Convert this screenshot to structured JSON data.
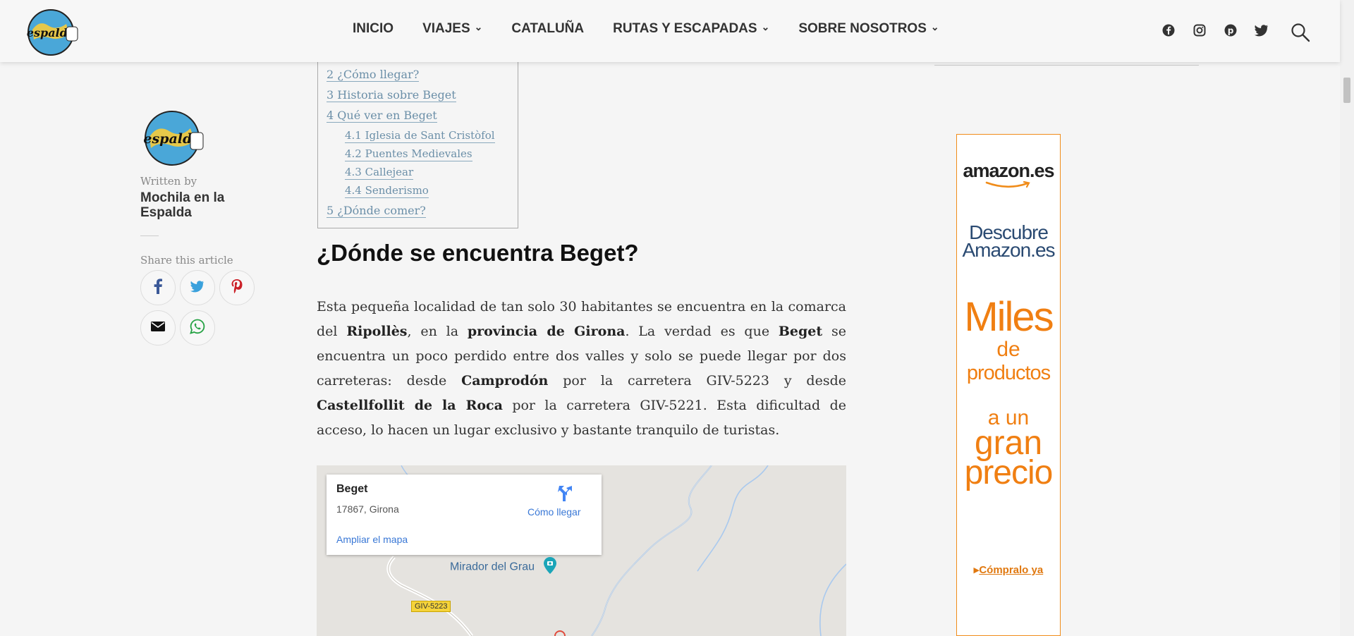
{
  "colors": {
    "accent": "#f07f12",
    "link": "#6b8fa8",
    "map_link": "#3a78d6",
    "header_bg": "#f7f7f7"
  },
  "logo": {
    "icon": "site-logo",
    "text": "espalda"
  },
  "nav": {
    "items": [
      {
        "label": "INICIO",
        "has_dropdown": false
      },
      {
        "label": "VIAJES",
        "has_dropdown": true
      },
      {
        "label": "CATALUÑA",
        "has_dropdown": false
      },
      {
        "label": "RUTAS Y ESCAPADAS",
        "has_dropdown": true
      },
      {
        "label": "SOBRE NOSOTROS",
        "has_dropdown": true
      }
    ],
    "social_icons": [
      "facebook-icon",
      "instagram-icon",
      "pinterest-icon",
      "twitter-icon"
    ],
    "search_icon": "search-icon"
  },
  "author": {
    "written_by": "Written by",
    "name": "Mochila en la Espalda",
    "share_label": "Share this article",
    "share_icons": [
      "facebook-icon",
      "twitter-icon",
      "pinterest-icon",
      "email-icon",
      "whatsapp-icon"
    ]
  },
  "toc": {
    "items": [
      {
        "label": "2 ¿Cómo llegar?",
        "level": 1
      },
      {
        "label": "3 Historia sobre Beget",
        "level": 1
      },
      {
        "label": "4 Qué ver en Beget",
        "level": 1
      },
      {
        "label": "4.1 Iglesia de Sant Cristòfol",
        "level": 2
      },
      {
        "label": "4.2 Puentes Medievales",
        "level": 2
      },
      {
        "label": "4.3 Callejear",
        "level": 2
      },
      {
        "label": "4.4 Senderismo",
        "level": 2
      },
      {
        "label": "5 ¿Dónde comer?",
        "level": 1
      }
    ]
  },
  "article": {
    "heading": "¿Dónde se encuentra Beget?",
    "paragraph": [
      {
        "t": "Esta pequeña localidad de tan solo 30 habitantes se encuentra en la comarca del ",
        "b": false
      },
      {
        "t": "Ripollès",
        "b": true
      },
      {
        "t": ", en la ",
        "b": false
      },
      {
        "t": "provincia de Girona",
        "b": true
      },
      {
        "t": ". La verdad es que ",
        "b": false
      },
      {
        "t": "Beget",
        "b": true
      },
      {
        "t": " se encuentra un poco perdido entre dos valles y solo se puede llegar por dos carreteras: desde ",
        "b": false
      },
      {
        "t": "Camprodón",
        "b": true
      },
      {
        "t": " por la carretera GIV-5223 y desde ",
        "b": false
      },
      {
        "t": "Castellfollit de la Roca",
        "b": true
      },
      {
        "t": " por la carretera GIV-5221. Esta dificultad de acceso, lo hacen un ",
        "b": false
      },
      {
        "t": "lugar exclusivo y bastante tranquilo de turistas.",
        "b": false
      }
    ]
  },
  "map": {
    "place": "Beget",
    "address": "17867, Girona",
    "directions": "Cómo llegar",
    "enlarge": "Ampliar el mapa",
    "poi": "Mirador del Grau",
    "road": "GIV-5223"
  },
  "ad": {
    "brand": "amazon.es",
    "line1": "Descubre",
    "line2": "Amazon.es",
    "big1": "Miles",
    "big2": "de",
    "big3": "productos",
    "big4": "a un",
    "big5": "gran",
    "big6": "precio",
    "cta": "Cómpralo ya"
  }
}
